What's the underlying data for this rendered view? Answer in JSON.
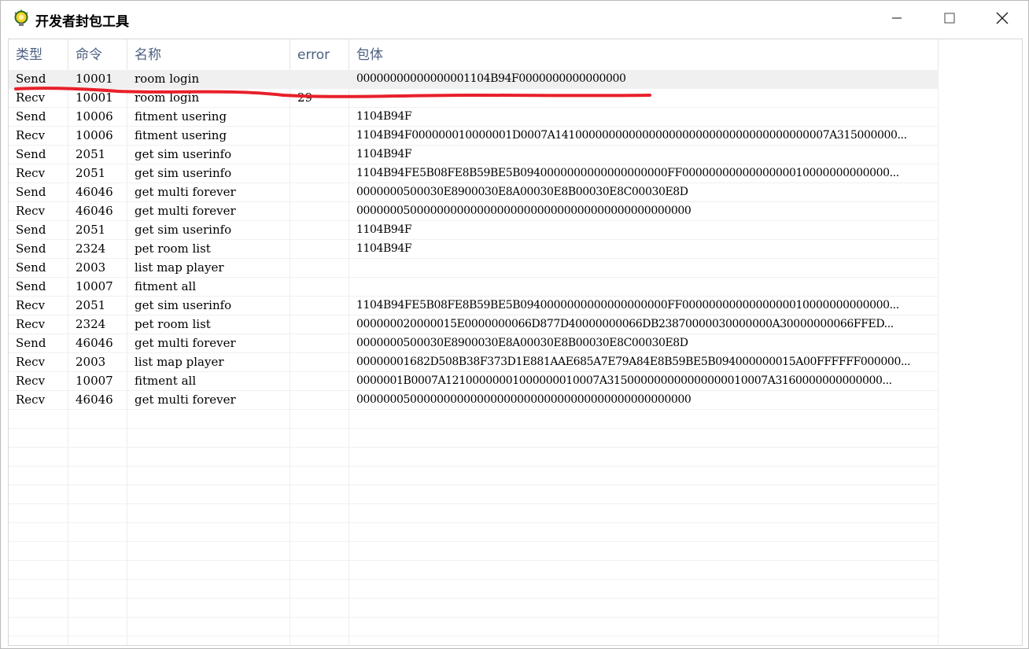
{
  "window": {
    "title": "开发者封包工具",
    "icon": "lightbulb-gear-icon"
  },
  "columns": [
    "类型",
    "命令",
    "名称",
    "error",
    "包体"
  ],
  "rows": [
    {
      "type": "Send",
      "cmd": "10001",
      "name": "room login",
      "error": "",
      "payload": "00000000000000001104B94F0000000000000000"
    },
    {
      "type": "Recv",
      "cmd": "10001",
      "name": "room login",
      "error": "29",
      "payload": ""
    },
    {
      "type": "Send",
      "cmd": "10006",
      "name": "fitment usering",
      "error": "",
      "payload": "1104B94F"
    },
    {
      "type": "Recv",
      "cmd": "10006",
      "name": "fitment usering",
      "error": "",
      "payload": "1104B94F000000010000001D0007A14100000000000000000000000000000000000007A315000000..."
    },
    {
      "type": "Send",
      "cmd": "2051",
      "name": "get sim userinfo",
      "error": "",
      "payload": "1104B94F"
    },
    {
      "type": "Recv",
      "cmd": "2051",
      "name": "get sim userinfo",
      "error": "",
      "payload": "1104B94FE5B08FE8B59BE5B0940000000000000000000FF0000000000000000010000000000000..."
    },
    {
      "type": "Send",
      "cmd": "46046",
      "name": "get multi forever",
      "error": "",
      "payload": "0000000500030E8900030E8A00030E8B00030E8C00030E8D"
    },
    {
      "type": "Recv",
      "cmd": "46046",
      "name": "get multi forever",
      "error": "",
      "payload": "00000005000000000000000000000000000000000000000000"
    },
    {
      "type": "Send",
      "cmd": "2051",
      "name": "get sim userinfo",
      "error": "",
      "payload": "1104B94F"
    },
    {
      "type": "Send",
      "cmd": "2324",
      "name": "pet room list",
      "error": "",
      "payload": "1104B94F"
    },
    {
      "type": "Send",
      "cmd": "2003",
      "name": "list map player",
      "error": "",
      "payload": ""
    },
    {
      "type": "Send",
      "cmd": "10007",
      "name": "fitment all",
      "error": "",
      "payload": ""
    },
    {
      "type": "Recv",
      "cmd": "2051",
      "name": "get sim userinfo",
      "error": "",
      "payload": "1104B94FE5B08FE8B59BE5B0940000000000000000000FF0000000000000000010000000000000..."
    },
    {
      "type": "Recv",
      "cmd": "2324",
      "name": "pet room list",
      "error": "",
      "payload": "000000020000015E0000000066D877D40000000066DB23870000030000000A30000000066FFED..."
    },
    {
      "type": "Send",
      "cmd": "46046",
      "name": "get multi forever",
      "error": "",
      "payload": "0000000500030E8900030E8A00030E8B00030E8C00030E8D"
    },
    {
      "type": "Recv",
      "cmd": "2003",
      "name": "list map player",
      "error": "",
      "payload": "00000001682D508B38F373D1E881AAE685A7E79A84E8B59BE5B094000000015A00FFFFFF000000..."
    },
    {
      "type": "Recv",
      "cmd": "10007",
      "name": "fitment all",
      "error": "",
      "payload": "0000001B0007A12100000001000000010007A315000000000000000010007A3160000000000000..."
    },
    {
      "type": "Recv",
      "cmd": "46046",
      "name": "get multi forever",
      "error": "",
      "payload": "00000005000000000000000000000000000000000000000000"
    }
  ],
  "selected_row": 0,
  "colors": {
    "header_text": "#4d6082",
    "selected_bg": "#f0f0f0",
    "annotation_stroke": "#e8202a"
  }
}
